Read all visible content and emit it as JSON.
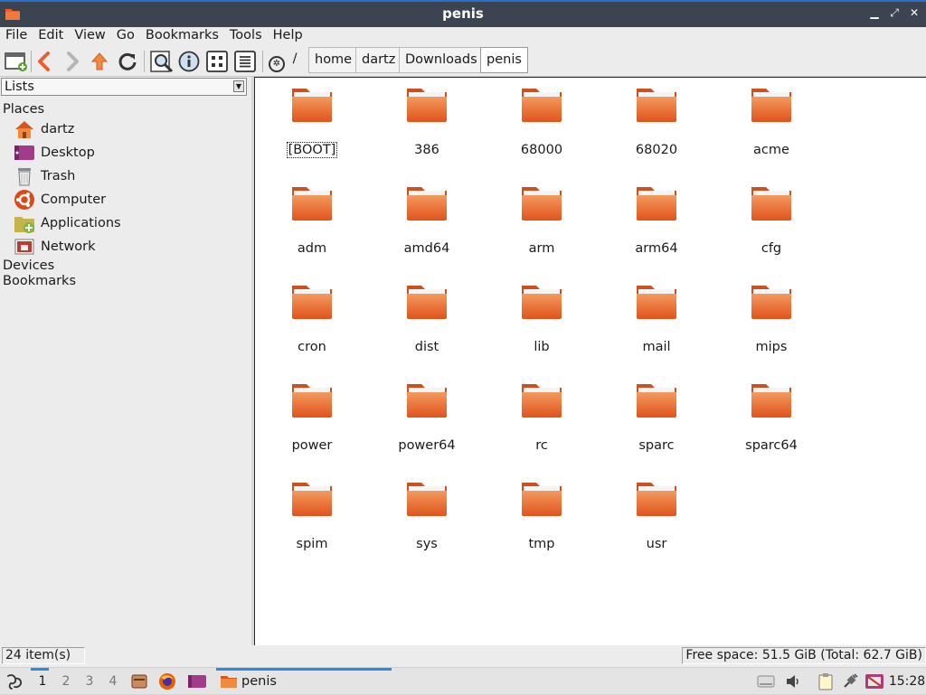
{
  "window": {
    "title": "penis"
  },
  "menu": [
    "File",
    "Edit",
    "View",
    "Go",
    "Bookmarks",
    "Tools",
    "Help"
  ],
  "toolbar": {
    "path_root": "/",
    "breadcrumbs": [
      "home",
      "dartz",
      "Downloads",
      "penis"
    ]
  },
  "sidebar": {
    "mode": "Lists",
    "places_heading": "Places",
    "places": [
      {
        "label": "dartz",
        "icon": "home-icon"
      },
      {
        "label": "Desktop",
        "icon": "desktop-icon"
      },
      {
        "label": "Trash",
        "icon": "trash-icon"
      },
      {
        "label": "Computer",
        "icon": "computer-icon"
      },
      {
        "label": "Applications",
        "icon": "applications-icon"
      },
      {
        "label": "Network",
        "icon": "network-icon"
      }
    ],
    "devices_heading": "Devices",
    "bookmarks_heading": "Bookmarks"
  },
  "files": [
    "[BOOT]",
    "386",
    "68000",
    "68020",
    "acme",
    "adm",
    "amd64",
    "arm",
    "arm64",
    "cfg",
    "cron",
    "dist",
    "lib",
    "mail",
    "mips",
    "power",
    "power64",
    "rc",
    "sparc",
    "sparc64",
    "spim",
    "sys",
    "tmp",
    "usr"
  ],
  "selected_file": "[BOOT]",
  "status": {
    "items": "24 item(s)",
    "free_space": "Free space: 51.5 GiB (Total: 62.7 GiB)"
  },
  "taskbar": {
    "desktops": [
      "1",
      "2",
      "3",
      "4"
    ],
    "current_desktop": "1",
    "task_label": "penis",
    "clock": "15:28"
  },
  "colors": {
    "folder": "#e8612c",
    "accent": "#2a8ae0",
    "titlebar": "#3c4452"
  }
}
